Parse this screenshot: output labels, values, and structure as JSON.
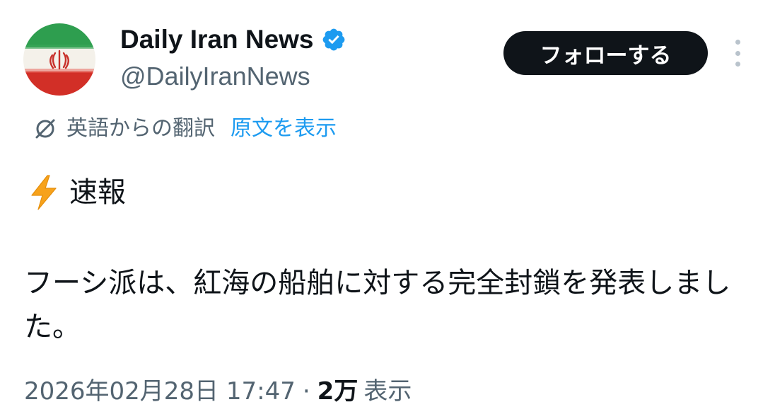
{
  "account": {
    "display_name": "Daily Iran News",
    "handle": "@DailyIranNews",
    "avatar_icon": "iran-flag-avatar",
    "verified_icon": "verified-badge-icon",
    "verified_color": "#1d9bf0"
  },
  "actions": {
    "follow_label": "フォローする",
    "more_icon": "more-vertical-icon"
  },
  "translation": {
    "icon": "translate-icon",
    "label": "英語からの翻訳",
    "show_original_label": "原文を表示",
    "link_color": "#1d9bf0"
  },
  "tweet": {
    "headline_icon": "lightning-bolt-emoji",
    "headline": "速報",
    "body": "フーシ派は、紅海の船舶に対する完全封鎖を発表しました。"
  },
  "meta": {
    "timestamp": "2026年02月28日 17:47",
    "separator": "·",
    "views_count": "2万",
    "views_label": "表示"
  }
}
